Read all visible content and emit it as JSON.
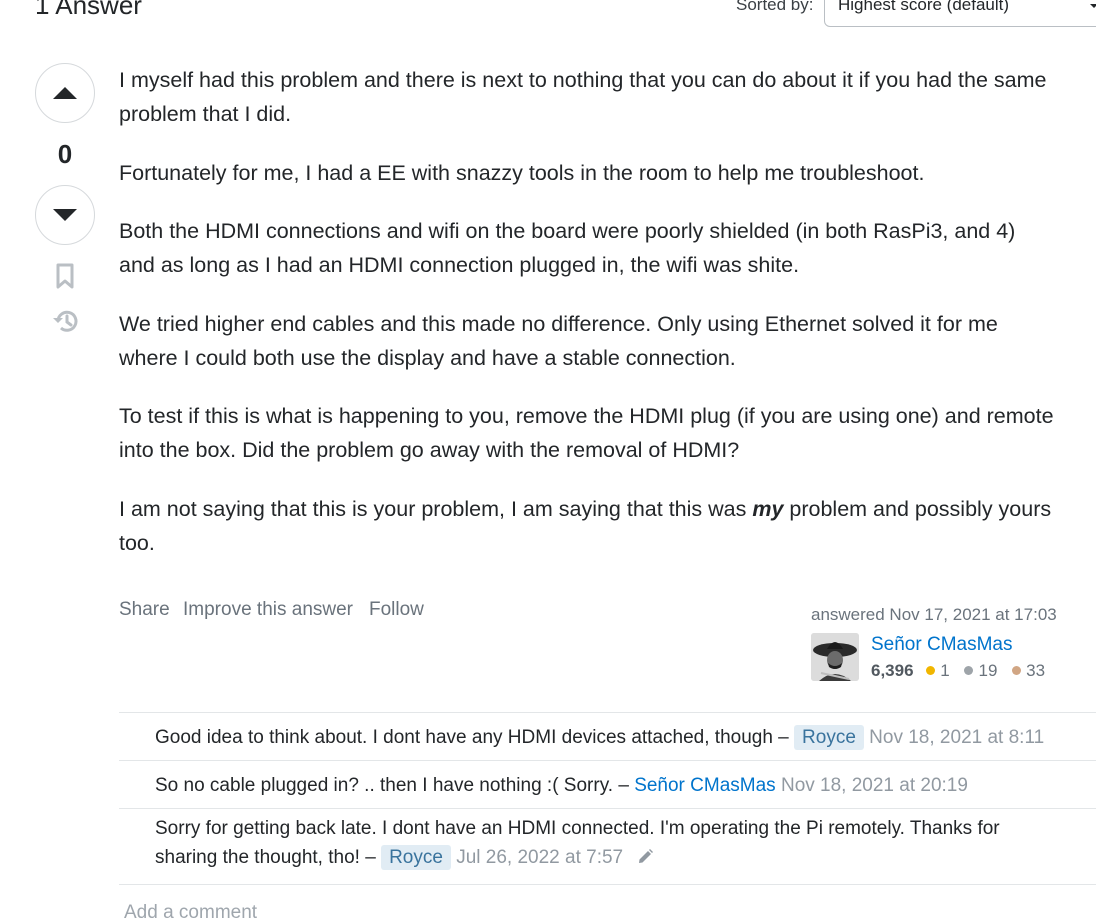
{
  "answers_header": {
    "count_label": "1 Answer",
    "sort_label": "Sorted by:",
    "sort_value": "Highest score (default)"
  },
  "vote": {
    "count": "0",
    "up_icon": "triangle-up-icon",
    "down_icon": "triangle-down-icon",
    "bookmark_icon": "bookmark-icon",
    "history_icon": "history-icon"
  },
  "answer": {
    "paragraphs": [
      {
        "lines": [
          "I myself had this problem and there is next to nothing that you can do about it if you had the same",
          "problem that I did."
        ]
      },
      {
        "lines": [
          "Fortunately for me, I had a EE with snazzy tools in the room to help me troubleshoot."
        ]
      },
      {
        "lines": [
          "Both the HDMI connections and wifi on the board were poorly shielded (in both RasPi3, and 4)",
          "and as long as I had an HDMI connection plugged in, the wifi was shite."
        ]
      },
      {
        "lines": [
          "We tried higher end cables and this made no difference. Only using Ethernet solved it for me",
          "where I could both use the display and have a stable connection."
        ]
      },
      {
        "lines": [
          "To test if this is what is happening to you, remove the HDMI plug (if you are using one) and remote",
          "into the box. Did the problem go away with the removal of HDMI?"
        ]
      }
    ],
    "last_paragraph": {
      "before": "I am not saying that this is your problem, I am saying that this was ",
      "emphasis": "my",
      "after": " problem and possibly yours",
      "line2": "too."
    }
  },
  "post_menu": {
    "share": "Share",
    "improve": "Improve this answer",
    "follow": "Follow"
  },
  "user_card": {
    "action": "answered Nov 17, 2021 at 17:03",
    "name": "Señor CMasMas",
    "reputation": "6,396",
    "gold": "1",
    "silver": "19",
    "bronze": "33",
    "colors": {
      "gold": "#f1b600",
      "silver": "#9ea4a9",
      "bronze": "#d1a684"
    }
  },
  "comments": [
    {
      "text": "Good idea to think about. I dont have any HDMI devices attached, though –",
      "user": "Royce",
      "date": "Nov 18, 2021 at 8:11"
    },
    {
      "text": "So no cable plugged in? .. then I have nothing :( Sorry. –",
      "user": "Señor CMasMas",
      "date": "Nov 18, 2021 at 20:19"
    },
    {
      "text_line1": "Sorry for getting back late. I dont have an HDMI connected. I'm operating the Pi remotely. Thanks for",
      "text_line2": "sharing the thought, tho! –",
      "user": "Royce",
      "date": "Jul 26, 2022 at 7:57",
      "edited_icon": "pencil-icon"
    }
  ],
  "add_comment": "Add a comment",
  "theme": {
    "link": "#0074cc",
    "text": "#232629",
    "muted": "#6a737c",
    "op_tag_bg": "#e1ecf4"
  }
}
